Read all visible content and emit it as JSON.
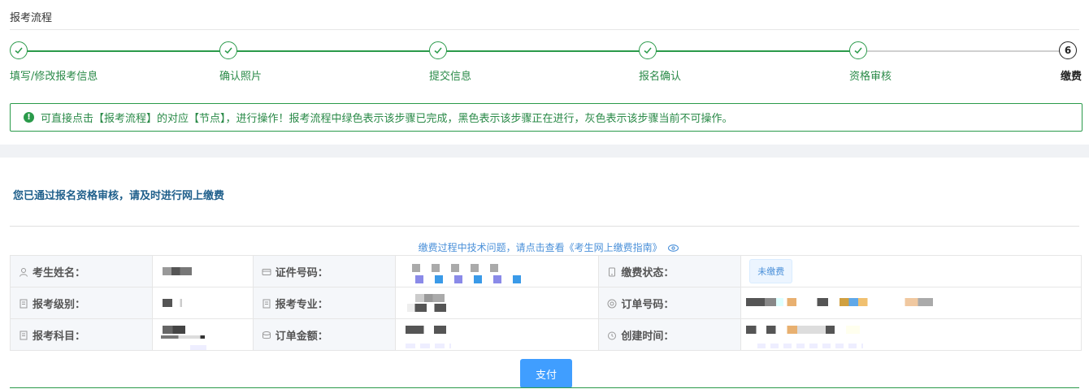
{
  "section_title": "报考流程",
  "steps": [
    {
      "label": "填写/修改报考信息",
      "state": "done"
    },
    {
      "label": "确认照片",
      "state": "done"
    },
    {
      "label": "提交信息",
      "state": "done"
    },
    {
      "label": "报名确认",
      "state": "done"
    },
    {
      "label": "资格审核",
      "state": "done"
    },
    {
      "label": "缴费",
      "state": "current",
      "number": "6"
    }
  ],
  "notice": "可直接点击【报考流程】的对应【节点】，进行操作！报考流程中绿色表示该步骤已完成，黑色表示该步骤正在进行，灰色表示该步骤当前不可操作。",
  "headline": "您已通过报名资格审核，请及时进行网上缴费",
  "guide_text": "缴费过程中技术问题，请点击查看《考生网上缴费指南》",
  "fields": {
    "name_label": "考生姓名：",
    "id_label": "证件号码：",
    "status_label": "缴费状态：",
    "status_value": "未缴费",
    "level_label": "报考级别：",
    "major_label": "报考专业：",
    "order_no_label": "订单号码：",
    "subject_label": "报考科目：",
    "amount_label": "订单金额：",
    "created_label": "创建时间："
  },
  "pay_button": "支付",
  "colors": {
    "done": "#2a9a4a",
    "current": "#222222",
    "pending": "#cccccc",
    "link": "#4a90d9",
    "button": "#409eff"
  }
}
